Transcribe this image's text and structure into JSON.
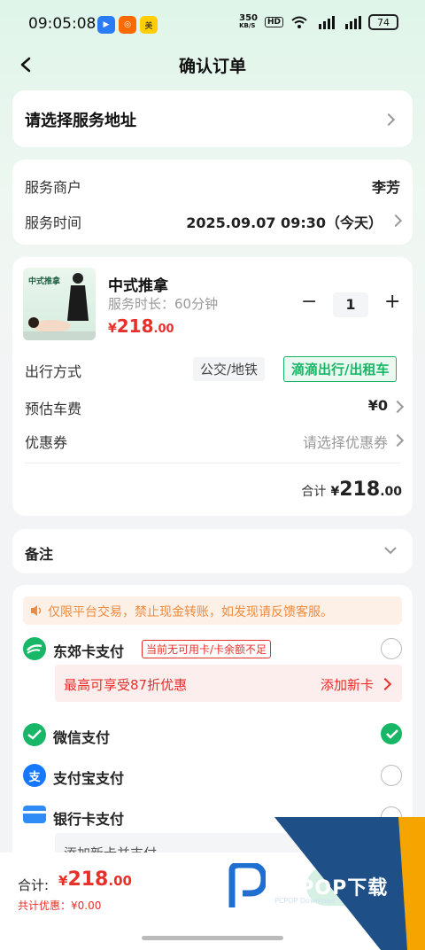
{
  "status": {
    "time": "09:05:08",
    "speed_value": "350",
    "speed_unit": "KB/S",
    "hd": "HD",
    "battery": "74"
  },
  "header": {
    "title": "确认订单"
  },
  "address": {
    "label": "请选择服务地址"
  },
  "merchant": {
    "label": "服务商户",
    "value": "李芳",
    "time_label": "服务时间",
    "time_value": "2025.09.07 09:30（今天）"
  },
  "service": {
    "thumb_text": "中式推拿",
    "name": "中式推拿",
    "duration": "服务时长：60分钟",
    "price_yen": "¥",
    "price_int": "218",
    "price_dec": ".00",
    "qty": "1",
    "minus": "−",
    "plus": "+",
    "travel_label": "出行方式",
    "travel_opt1": "公交/地铁",
    "travel_opt2": "滴滴出行/出租车",
    "fare_label": "预估车费",
    "fare_value": "¥0",
    "coupon_label": "优惠券",
    "coupon_value": "请选择优惠券",
    "total_label": "合计",
    "total_yen": "¥",
    "total_int": "218",
    "total_dec": ".00"
  },
  "remark": {
    "label": "备注"
  },
  "payment": {
    "notice": "仅限平台交易，禁止现金转账，如发现请反馈客服。",
    "card_label": "东郊卡支付",
    "card_badge": "当前无可用卡/卡余额不足",
    "card_promo": "最高可享受87折优惠",
    "card_add": "添加新卡",
    "wechat_label": "微信支付",
    "alipay_label": "支付宝支付",
    "alipay_icon": "支",
    "bank_label": "银行卡支付",
    "bank_sub": "添加新卡并支付"
  },
  "bottom": {
    "total_label": "合计:",
    "total_yen": "¥",
    "total_int": "218",
    "total_dec": ".00",
    "discount": "共计优惠：¥0.00"
  },
  "watermark": {
    "brand": "PCPOP下载",
    "sub": "PCPOP Download"
  },
  "colors": {
    "green": "#18b767",
    "red": "#e8302a",
    "orange": "#f08a3c"
  }
}
